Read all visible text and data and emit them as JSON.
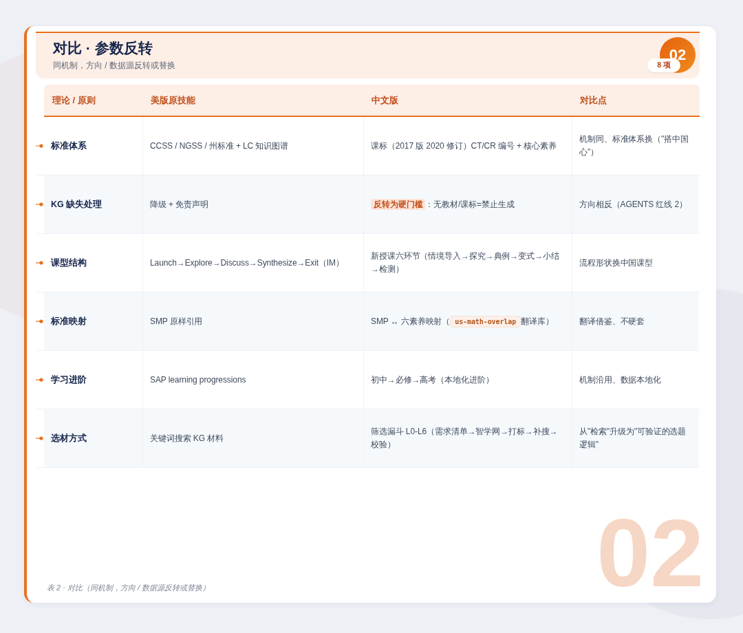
{
  "header": {
    "title": "对比 · 参数反转",
    "subtitle": "同机制，方向 / 数据源反转或替换",
    "number": "02",
    "count_badge": "8 项"
  },
  "table": {
    "columns": [
      "理论 / 原则",
      "美版原技能",
      "中文版",
      "对比点"
    ],
    "rows": [
      {
        "principle": "标准体系",
        "us": [
          {
            "kind": "text",
            "text": "CCSS / NGSS / 州标准 + LC 知识图谱"
          }
        ],
        "cn": [
          {
            "kind": "text",
            "text": "课标（2017 版 2020 修订）CT/CR 编号 + 核心素养"
          }
        ],
        "contrast": "机制同、标准体系换（\"搭中国心\"）"
      },
      {
        "principle": "KG 缺失处理",
        "us": [
          {
            "kind": "text",
            "text": "降级 + 免责声明"
          }
        ],
        "cn": [
          {
            "kind": "highlight",
            "text": "反转为硬门槛"
          },
          {
            "kind": "text",
            "text": "：无教材/课标=禁止生成"
          }
        ],
        "contrast": "方向相反（AGENTS 红线 2）"
      },
      {
        "principle": "课型结构",
        "us": [
          {
            "kind": "text",
            "text": "Launch→Explore→Discuss→Synthesize→Exit（IM）"
          }
        ],
        "cn": [
          {
            "kind": "text",
            "text": "新授课六环节（情境导入→探究→典例→变式→小结→检测）"
          }
        ],
        "contrast": "流程形状换中国课型"
      },
      {
        "principle": "标准映射",
        "us": [
          {
            "kind": "text",
            "text": "SMP 原样引用"
          }
        ],
        "cn": [
          {
            "kind": "text",
            "text": "SMP ↔ 六素养映射（"
          },
          {
            "kind": "code",
            "text": "us-math-overlap"
          },
          {
            "kind": "text",
            "text": "翻译库）"
          }
        ],
        "contrast": "翻译借鉴、不硬套"
      },
      {
        "principle": "学习进阶",
        "us": [
          {
            "kind": "text",
            "text": "SAP learning progressions"
          }
        ],
        "cn": [
          {
            "kind": "text",
            "text": "初中→必修→高考（本地化进阶）"
          }
        ],
        "contrast": "机制沿用、数据本地化"
      },
      {
        "principle": "选材方式",
        "us": [
          {
            "kind": "text",
            "text": "关键词搜索 KG 材料"
          }
        ],
        "cn": [
          {
            "kind": "text",
            "text": "筛选漏斗 L0-L6（需求清单→智学网→打标→补搜→校验）"
          }
        ],
        "contrast": "从\"检索\"升级为\"可验证的选题逻辑\""
      }
    ]
  },
  "caption": "表 2 · 对比（同机制，方向 / 数据源反转或替换）",
  "background_number": "02"
}
